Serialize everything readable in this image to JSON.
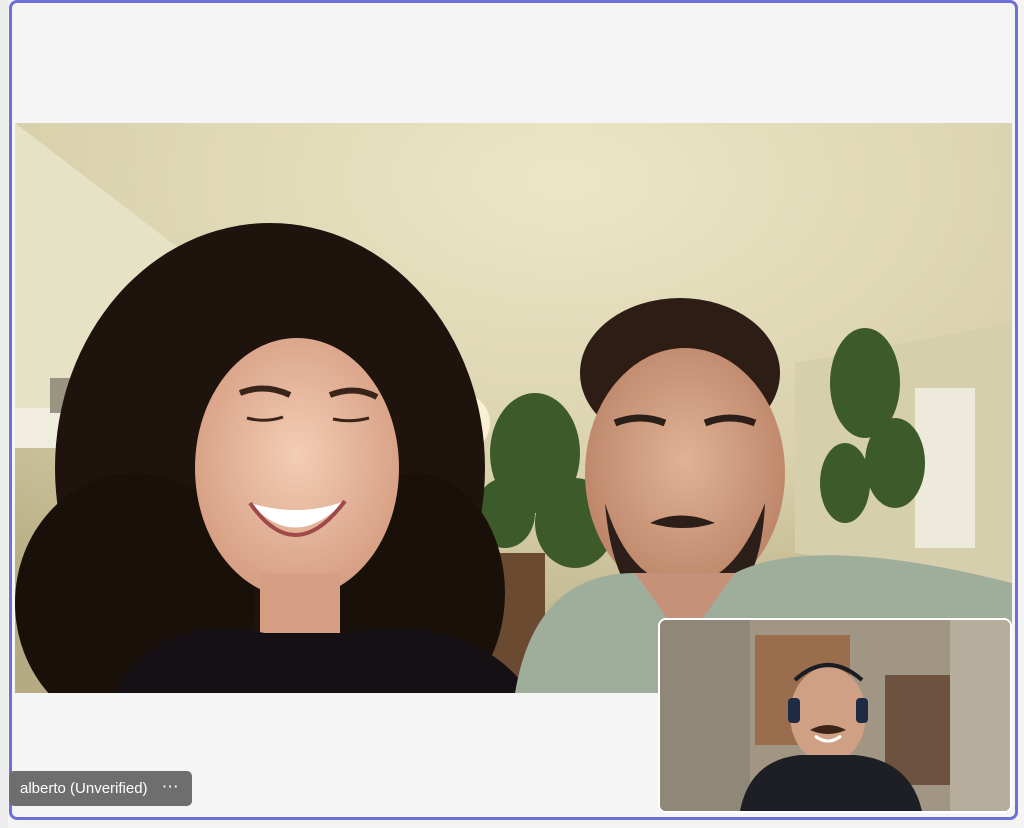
{
  "participant": {
    "name": "alberto (Unverified)",
    "more_icon": "more-horizontal-icon",
    "more_glyph": "⋯"
  },
  "colors": {
    "window_border": "#6f6fd8",
    "window_background": "#f5f5f5",
    "badge_background": "#6e6e6e"
  }
}
